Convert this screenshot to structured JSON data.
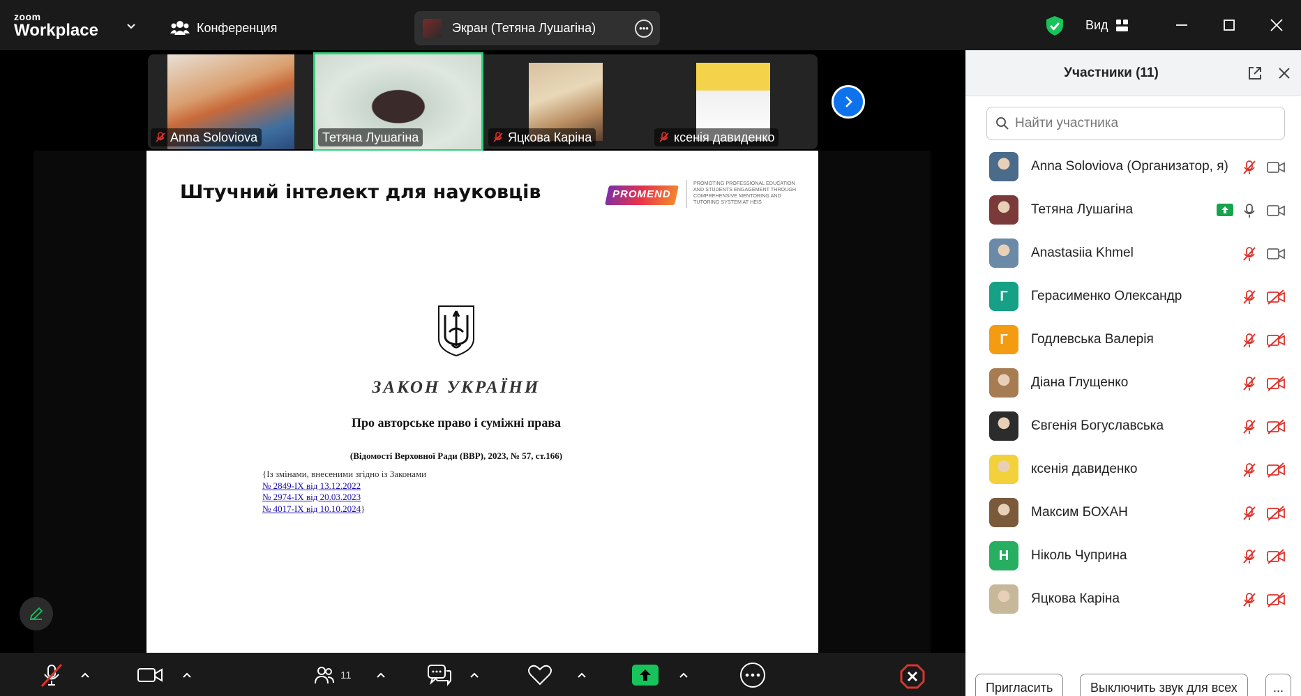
{
  "app": {
    "logo_top": "zoom",
    "logo_bottom": "Workplace",
    "conference_label": "Конференция",
    "screen_share_label": "Экран (Тетяна Лушагіна)",
    "view_label": "Вид"
  },
  "tiles": [
    {
      "name": "Anna Soloviova",
      "muted": true,
      "active": false
    },
    {
      "name": "Тетяна Лушагіна",
      "muted": false,
      "active": true
    },
    {
      "name": "Яцкова Каріна",
      "muted": true,
      "active": false
    },
    {
      "name": "ксенія давиденко",
      "muted": true,
      "active": false
    }
  ],
  "slide": {
    "title": "Штучний інтелект для науковців",
    "brand_logo": "PROMEND",
    "brand_tagline": "PROMOTING PROFESSIONAL EDUCATION AND STUDENTS ENGAGEMENT THROUGH COMPREHENSIVE MENTORING AND TUTORING SYSTEM AT HEIS",
    "law_title": "ЗАКОН УКРАЇНИ",
    "law_subtitle": "Про авторське право і суміжні права",
    "law_source": "(Відомості Верховної Ради (ВВР), 2023, № 57, ст.166)",
    "changes_intro": "{Із змінами, внесеними згідно із Законами",
    "changes": [
      {
        "num": "№ 2849-IX",
        "date": "від 13.12.2022"
      },
      {
        "num": "№ 2974-IX",
        "date": "від 20.03.2023"
      },
      {
        "num": "№ 4017-IX",
        "date": "від 10.10.2024"
      }
    ],
    "changes_close": "}"
  },
  "toolbar": {
    "participants_count": "11"
  },
  "panel": {
    "title": "Участники (11)",
    "search_placeholder": "Найти участника",
    "participants": [
      {
        "name": "Anna Soloviova (Организатор, я)",
        "avatar": "photo",
        "color": "#4a6b8a",
        "mic": "off",
        "cam": "on",
        "sharing": false
      },
      {
        "name": "Тетяна Лушагіна",
        "avatar": "photo",
        "color": "#7a3a3a",
        "mic": "on",
        "cam": "on",
        "sharing": true
      },
      {
        "name": "Anastasiia Khmel",
        "avatar": "photo",
        "color": "#6a8aa8",
        "mic": "off",
        "cam": "on",
        "sharing": false
      },
      {
        "name": "Герасименко Олександр",
        "avatar": "Г",
        "color": "#16a085",
        "mic": "off",
        "cam": "off",
        "sharing": false
      },
      {
        "name": "Годлевська Валерія",
        "avatar": "Г",
        "color": "#f39c12",
        "mic": "off",
        "cam": "off",
        "sharing": false
      },
      {
        "name": "Діана Глущенко",
        "avatar": "photo",
        "color": "#a67c52",
        "mic": "off",
        "cam": "off",
        "sharing": false
      },
      {
        "name": "Євгенія Богуславська",
        "avatar": "photo",
        "color": "#2c2c2c",
        "mic": "off",
        "cam": "off",
        "sharing": false
      },
      {
        "name": "ксенія давиденко",
        "avatar": "photo",
        "color": "#f2d13a",
        "mic": "off",
        "cam": "off",
        "sharing": false
      },
      {
        "name": "Максим БОХАН",
        "avatar": "photo",
        "color": "#7a5a3a",
        "mic": "off",
        "cam": "off",
        "sharing": false
      },
      {
        "name": "Ніколь Чуприна",
        "avatar": "Н",
        "color": "#27ae60",
        "mic": "off",
        "cam": "off",
        "sharing": false
      },
      {
        "name": "Яцкова Каріна",
        "avatar": "photo",
        "color": "#c8b89a",
        "mic": "off",
        "cam": "off",
        "sharing": false
      }
    ],
    "invite_label": "Пригласить",
    "mute_all_label": "Выключить звук для всех",
    "more_label": "..."
  },
  "colors": {
    "accent_green": "#17c35b",
    "active_tile_border": "#2fd37a",
    "muted_red": "#e0312a",
    "end_red": "#e0312a",
    "next_blue": "#0e72ed"
  }
}
